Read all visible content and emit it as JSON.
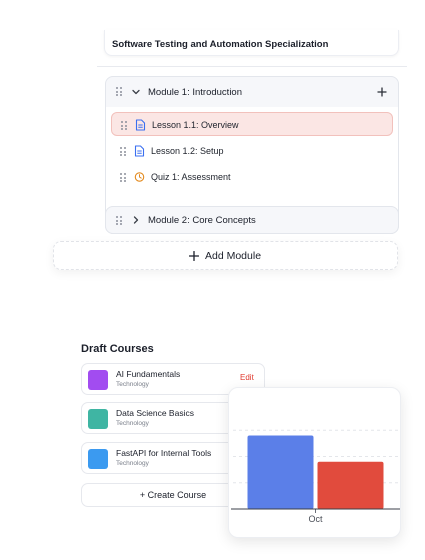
{
  "course": {
    "title": "Software Testing and Automation Specialization"
  },
  "modules": [
    {
      "label": "Module 1: Introduction",
      "expanded": true,
      "items": [
        {
          "label": "Lesson 1.1: Overview",
          "type": "lesson",
          "icon": "document-icon",
          "selected": true
        },
        {
          "label": "Lesson 1.2: Setup",
          "type": "lesson",
          "icon": "document-icon",
          "selected": false
        },
        {
          "label": "Quiz 1: Assessment",
          "type": "quiz",
          "icon": "clock-icon",
          "selected": false
        }
      ]
    },
    {
      "label": "Module 2: Core Concepts",
      "expanded": false
    }
  ],
  "add_module_label": "Add Module",
  "drafts": {
    "title": "Draft Courses",
    "edit_label": "Edit",
    "courses": [
      {
        "name": "AI Fundamentals",
        "category": "Technology",
        "color": "#a24cf0"
      },
      {
        "name": "Data Science Basics",
        "category": "Technology",
        "color": "#3fb5a3"
      },
      {
        "name": "FastAPI for Internal Tools",
        "category": "Technology",
        "color": "#3b9af0"
      }
    ],
    "create_label": "+ Create Course"
  },
  "chart_data": {
    "type": "bar",
    "categories": [
      "Oct"
    ],
    "series": [
      {
        "values": [
          7
        ],
        "color": "#5b7fe8"
      },
      {
        "values": [
          4.5
        ],
        "color": "#e14b3d"
      }
    ],
    "ylim": [
      0,
      10
    ],
    "grid": true
  },
  "colors": {
    "accent_red": "#e03a2f",
    "selected_bg": "#fbe6e4",
    "doc_blue": "#3b6ff0",
    "quiz_orange": "#e38a1e"
  }
}
